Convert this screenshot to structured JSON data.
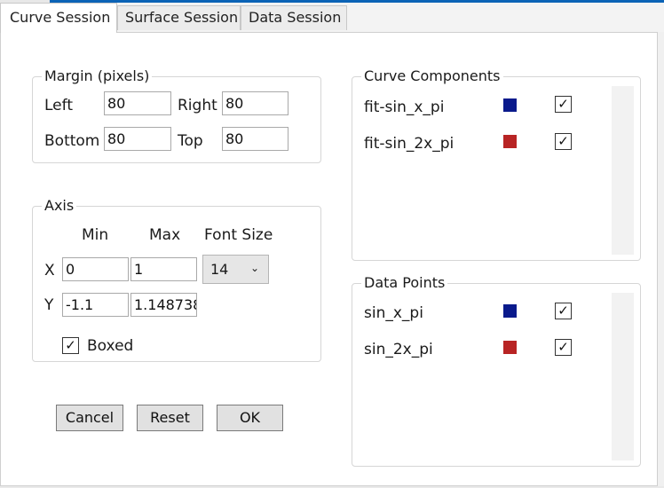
{
  "tabs": [
    {
      "label": "Curve Session"
    },
    {
      "label": "Surface Session"
    },
    {
      "label": "Data Session"
    }
  ],
  "margin": {
    "title": "Margin (pixels)",
    "left_label": "Left",
    "left_value": "80",
    "right_label": "Right",
    "right_value": "80",
    "bottom_label": "Bottom",
    "bottom_value": "80",
    "top_label": "Top",
    "top_value": "80"
  },
  "axis": {
    "title": "Axis",
    "min_header": "Min",
    "max_header": "Max",
    "fontsize_header": "Font Size",
    "x_label": "X",
    "x_min": "0",
    "x_max": "1",
    "font_size": "14",
    "y_label": "Y",
    "y_min": "-1.1",
    "y_max": "1.148738",
    "boxed_label": "Boxed",
    "boxed_checked": true
  },
  "buttons": {
    "cancel": "Cancel",
    "reset": "Reset",
    "ok": "OK"
  },
  "curve_components": {
    "title": "Curve Components",
    "items": [
      {
        "name": "fit-sin_x_pi",
        "color": "#0a1a8c",
        "checked": true
      },
      {
        "name": "fit-sin_2x_pi",
        "color": "#b82424",
        "checked": true
      }
    ]
  },
  "data_points": {
    "title": "Data Points",
    "items": [
      {
        "name": "sin_x_pi",
        "color": "#0a1a8c",
        "checked": true
      },
      {
        "name": "sin_2x_pi",
        "color": "#b82424",
        "checked": true
      }
    ]
  },
  "icons": {
    "check": "✓",
    "chevron": "⌄"
  }
}
